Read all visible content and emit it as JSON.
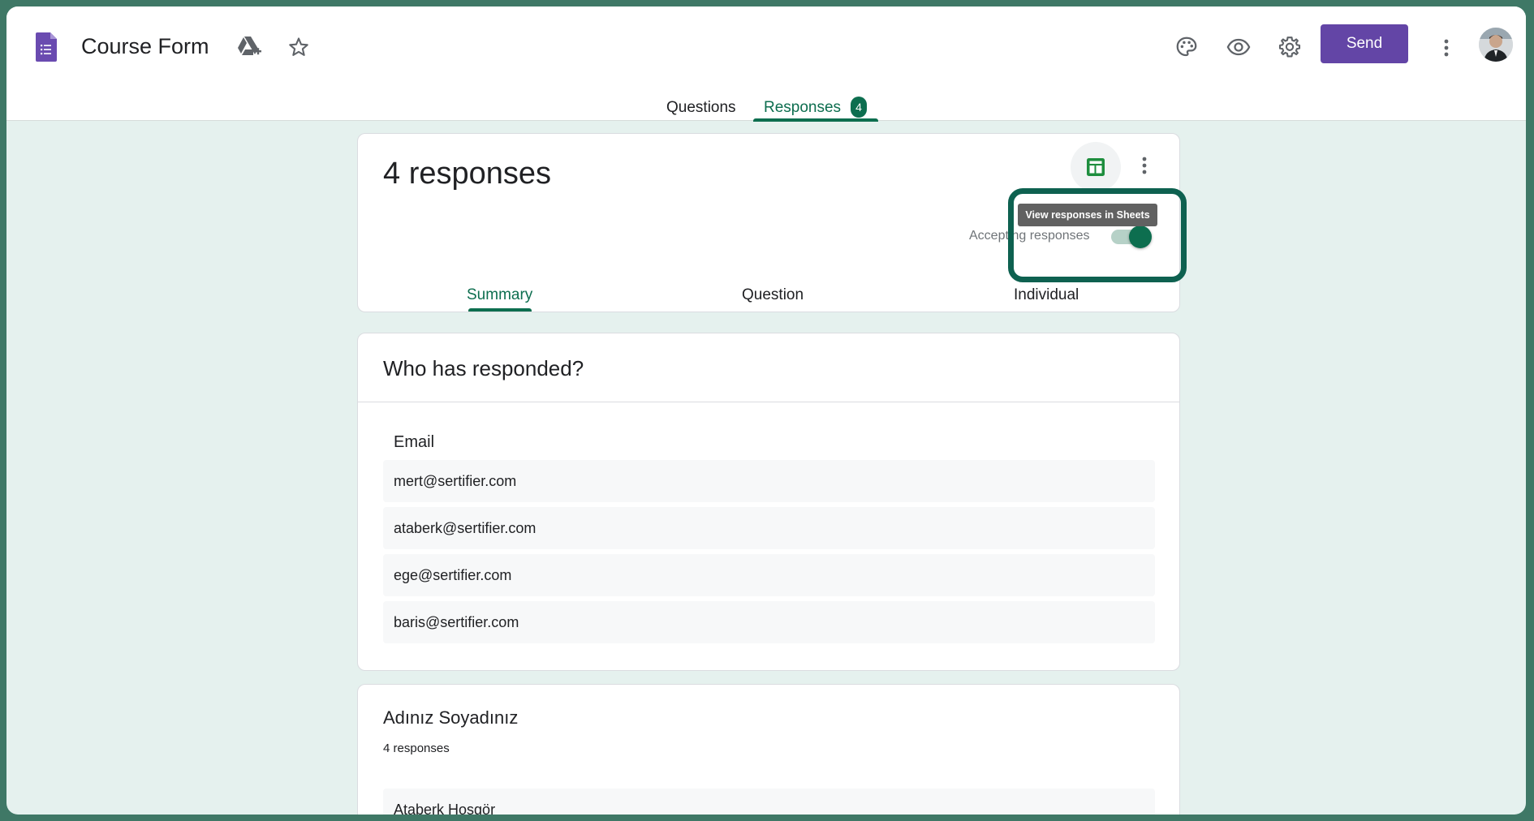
{
  "header": {
    "title": "Course Form",
    "send_label": "Send",
    "tabs": [
      {
        "label": "Questions"
      },
      {
        "label": "Responses",
        "badge": "4"
      }
    ]
  },
  "summary_card": {
    "count_label": "4 responses",
    "accepting_label": "Accepting responses",
    "accepting_on": true,
    "tooltip": "View responses in Sheets",
    "sub_tabs": [
      {
        "label": "Summary"
      },
      {
        "label": "Question"
      },
      {
        "label": "Individual"
      }
    ]
  },
  "who_card": {
    "title": "Who has responded?",
    "column_label": "Email",
    "emails": [
      "mert@sertifier.com",
      "ataberk@sertifier.com",
      "ege@sertifier.com",
      "baris@sertifier.com"
    ]
  },
  "name_card": {
    "title": "Adınız Soyadınız",
    "count_label": "4 responses",
    "first_response": "Ataberk Hoşgör"
  },
  "colors": {
    "accent": "#0d6e4f",
    "send_button": "#6345a6",
    "page_background": "#e5f1ee",
    "frame": "#3f7866"
  },
  "icons": [
    "google-forms-logo-icon",
    "drive-add-icon",
    "star-icon",
    "palette-icon",
    "eye-icon",
    "gear-icon",
    "more-vert-icon",
    "sheets-icon"
  ]
}
